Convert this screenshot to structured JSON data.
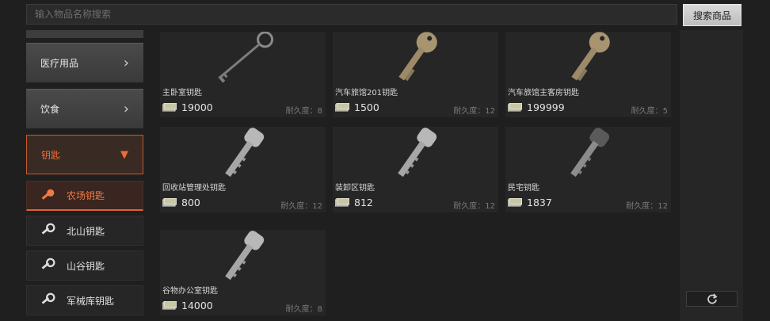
{
  "search": {
    "placeholder": "输入物品名称搜索",
    "button_label": "搜索商品"
  },
  "sidebar": {
    "categories": [
      {
        "label": "医疗用品",
        "state": "collapsed"
      },
      {
        "label": "饮食",
        "state": "collapsed"
      },
      {
        "label": "钥匙",
        "state": "expanded"
      }
    ],
    "sub_items": [
      {
        "label": "农场钥匙",
        "active": true
      },
      {
        "label": "北山钥匙",
        "active": false
      },
      {
        "label": "山谷钥匙",
        "active": false
      },
      {
        "label": "军械库钥匙",
        "active": false
      }
    ]
  },
  "items": [
    {
      "name": "主卧室钥匙",
      "price": "19000",
      "durability": "耐久度：8",
      "icon": "skeleton-key-icon"
    },
    {
      "name": "汽车旅馆201钥匙",
      "price": "1500",
      "durability": "耐久度：12",
      "icon": "brass-key-icon"
    },
    {
      "name": "汽车旅馆主客房钥匙",
      "price": "199999",
      "durability": "耐久度：5",
      "icon": "brass-key-icon"
    },
    {
      "name": "回收站管理处钥匙",
      "price": "800",
      "durability": "耐久度：12",
      "icon": "silver-key-icon"
    },
    {
      "name": "装卸区钥匙",
      "price": "812",
      "durability": "耐久度：12",
      "icon": "silver-key-icon"
    },
    {
      "name": "民宅钥匙",
      "price": "1837",
      "durability": "耐久度：12",
      "icon": "dark-key-icon"
    },
    {
      "name": "谷物办公室钥匙",
      "price": "14000",
      "durability": "耐久度：8",
      "icon": "silver-key-icon"
    }
  ],
  "colors": {
    "accent": "#f06c33",
    "background": "#1f1f1f",
    "card": "#262626"
  }
}
